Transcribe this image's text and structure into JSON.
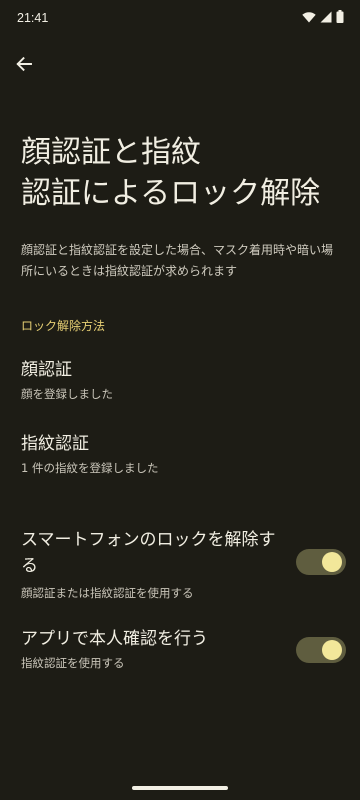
{
  "status_bar": {
    "time": "21:41",
    "icons": [
      "wifi-icon",
      "signal-icon",
      "battery-icon"
    ]
  },
  "navigation": {
    "back_icon": "arrow-back-icon"
  },
  "page": {
    "title": "顔認証と指紋\n認証によるロック解除",
    "description": "顔認証と指紋認証を設定した場合、マスク着用時や暗い場所にいるときは指紋認証が求められます"
  },
  "section": {
    "header": "ロック解除方法"
  },
  "items": {
    "face": {
      "title": "顔認証",
      "summary": "顔を登録しました"
    },
    "fingerprint": {
      "title": "指紋認証",
      "summary": "1 件の指紋を登録しました"
    },
    "unlock_phone": {
      "title": "スマートフォンのロックを解除する",
      "summary": "顔認証または指紋認証を使用する",
      "enabled": true
    },
    "app_verify": {
      "title": "アプリで本人確認を行う",
      "summary": "指紋認証を使用する",
      "enabled": true
    }
  },
  "colors": {
    "background": "#1d1c15",
    "accent": "#e6cf74",
    "toggle_track": "#5f5d3f",
    "toggle_knob": "#f2e79a"
  }
}
